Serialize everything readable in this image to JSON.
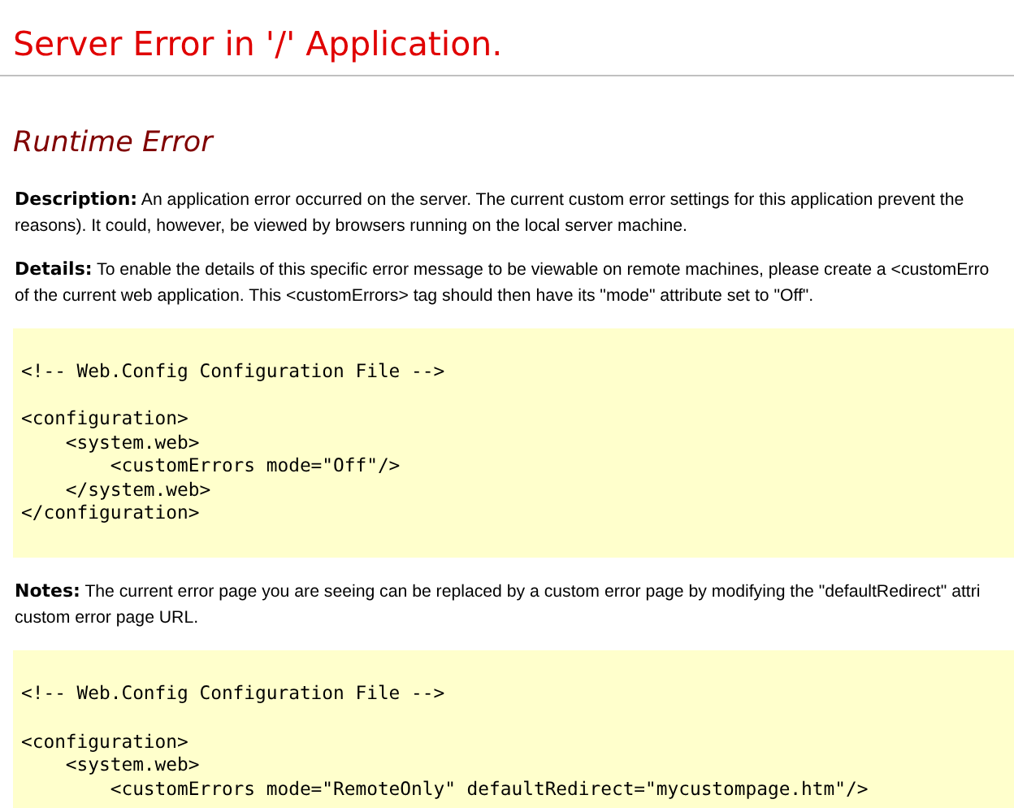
{
  "title": "Server Error in '/' Application.",
  "subtitle": "Runtime Error",
  "sections": [
    {
      "kind": "text",
      "lines": [
        "**Description:** An application error occurred on the server. The current custom error settings for this application prevent the",
        "reasons). It could, however, be viewed by browsers running on the local server machine."
      ]
    },
    {
      "kind": "text",
      "lines": [
        "**Details:** To enable the details of this specific error message to be viewable on remote machines, please create a <customErro",
        "of the current web application. This <customErrors> tag should then have its \"mode\" attribute set to \"Off\"."
      ]
    },
    {
      "kind": "code",
      "groups": [
        [
          "<!-- Web.Config Configuration File -->"
        ],
        [
          "<configuration>",
          "    <system.web>",
          "        <customErrors mode=\"Off\"/>",
          "    </system.web>",
          "</configuration>"
        ]
      ]
    },
    {
      "kind": "text",
      "lines": [
        "**Notes:** The current error page you are seeing can be replaced by a custom error page by modifying the \"defaultRedirect\" attri",
        "custom error page URL."
      ]
    },
    {
      "kind": "code",
      "groups": [
        [
          "<!-- Web.Config Configuration File -->"
        ],
        [
          "<configuration>",
          "    <system.web>",
          "        <customErrors mode=\"RemoteOnly\" defaultRedirect=\"mycustompage.htm\"/>"
        ]
      ]
    }
  ]
}
